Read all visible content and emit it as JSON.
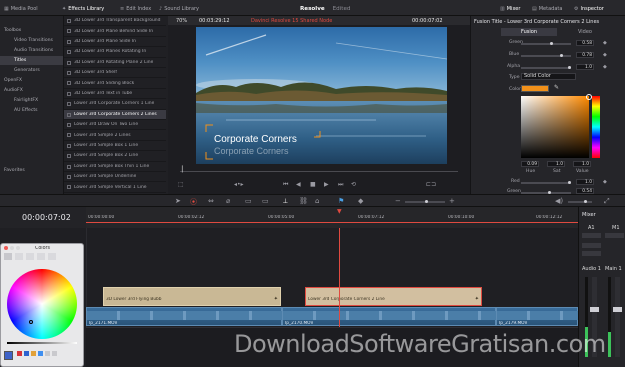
{
  "topbar": {
    "media_pool": "Media Pool",
    "effects_library": "Effects Library",
    "edit_index": "Edit Index",
    "sound_library": "Sound Library",
    "app_title": "Resolve",
    "edited_status": "Edited",
    "mixer": "Mixer",
    "metadata": "Metadata",
    "inspector": "Inspector"
  },
  "viewer": {
    "zoom": "70%",
    "timecode_left": "00:03:29:12",
    "project": "Davinci Resolve 15 Shared Node",
    "timecode_right": "00:00:07:02",
    "title_main": "Corporate Corners",
    "title_sub": "Corporate Corners"
  },
  "sidebar": {
    "items": [
      {
        "label": "Toolbox"
      },
      {
        "label": "Video Transitions"
      },
      {
        "label": "Audio Transitions"
      },
      {
        "label": "Titles"
      },
      {
        "label": "Generators"
      },
      {
        "label": "OpenFX"
      },
      {
        "label": "AudioFX"
      },
      {
        "label": "FairlightFX"
      },
      {
        "label": "AU Effects"
      }
    ],
    "favorites": "Favorites"
  },
  "effects": [
    "3D Lower 3rd Transparent Background",
    "3D Lower 3rd Plane Behind Slide In",
    "3D Lower 3rd Plane Slide In",
    "3D Lower 3rd Planes Rotating In",
    "3D Lower 3rd Rotating Plane 2 Line",
    "3D Lower 3rd Shelf",
    "3D Lower 3rd Sliding Block",
    "3D Lower 3rd Text in Tube",
    "Lower 3rd Corporate Corners 1 Line",
    "Lower 3rd Corporate Corners 2 Lines",
    "Lower 3rd Draw On Two Line",
    "Lower 3rd Simple 2 Lines",
    "Lower 3rd Simple Box 1 Line",
    "Lower 3rd Simple Box 2 Line",
    "Lower 3rd Simple Box Thin 1 Line",
    "Lower 3rd Simple Underline",
    "Lower 3rd Simple Vertical 1 Line"
  ],
  "effects_selected_index": 9,
  "inspector": {
    "title": "Fusion Title - Lower 3rd Corporate Corners 2 Lines",
    "tab_fusion": "Fusion",
    "tab_video": "Video",
    "green_label": "Green",
    "green_value": "0.58",
    "blue_label": "Blue",
    "blue_value": "0.78",
    "alpha_label": "Alpha",
    "alpha_value": "1.0",
    "type_label": "Type",
    "type_value": "Solid Color",
    "color_label": "Color",
    "hue_value": "0.09",
    "sat_value": "1.0",
    "val_value": "1.0",
    "hue_label": "Hue",
    "sat_label": "Sat",
    "val_label": "Value",
    "red_label": "Red",
    "red_value": "1.0",
    "green2_label": "Green",
    "green2_value": "0.54",
    "accent_color": "#f0901a"
  },
  "timeline": {
    "timecode": "00:00:07:02",
    "ruler": [
      "00:00:00:00",
      "00:00:02:12",
      "00:00:05:00",
      "00:00:07:12",
      "00:00:10:00",
      "00:00:12:12"
    ],
    "clip1": "3D Lower 3rd Flying Bubb",
    "clip2": "Lower 3rd Corporate Corners 2 Line",
    "video1": "Ip_2171.MOV",
    "video2": "Ip_2170.MOV",
    "video3": "Ip_2179.MOV"
  },
  "mixer": {
    "title": "Mixer",
    "a1": "A1",
    "m1": "M1",
    "audio1": "Audio 1",
    "main1": "Main 1"
  },
  "colors_dialog": {
    "title": "Colors"
  },
  "watermark": "DownloadSoftwareGratisan.com"
}
